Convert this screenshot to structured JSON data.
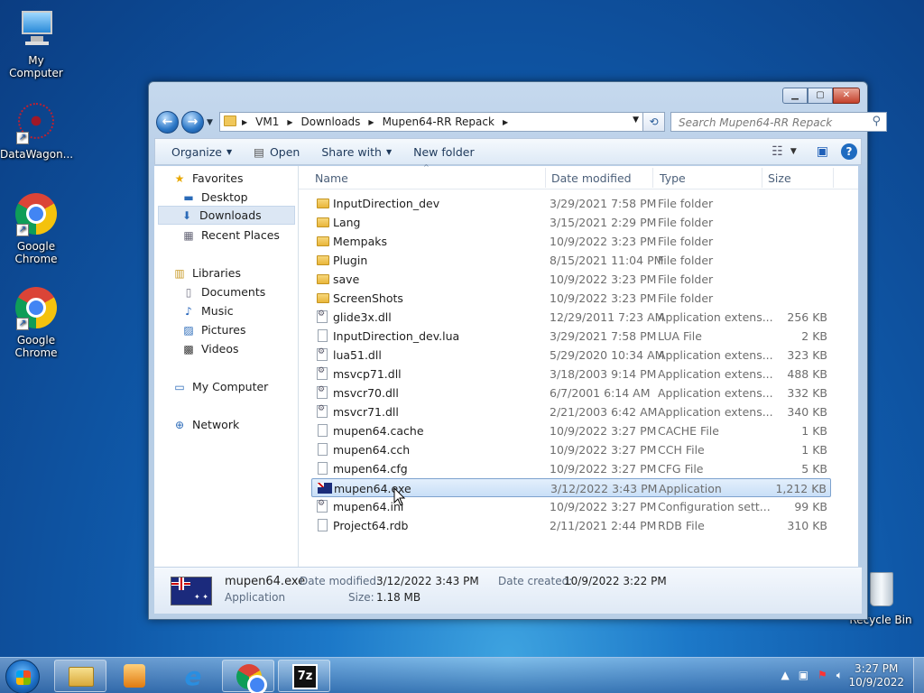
{
  "desktop": {
    "icons": [
      {
        "label": "My Computer"
      },
      {
        "label": "DataWagon..."
      },
      {
        "label": "Google Chrome"
      },
      {
        "label": "Google Chrome"
      },
      {
        "label": "Recycle Bin"
      }
    ]
  },
  "window": {
    "address": {
      "crumbs": [
        "VM1",
        "Downloads",
        "Mupen64-RR Repack"
      ]
    },
    "search": {
      "placeholder": "Search Mupen64-RR Repack"
    },
    "toolbar": {
      "organize": "Organize",
      "open": "Open",
      "share_with": "Share with",
      "new_folder": "New folder"
    },
    "nav": {
      "favorites": "Favorites",
      "desktop": "Desktop",
      "downloads": "Downloads",
      "recent_places": "Recent Places",
      "libraries": "Libraries",
      "documents": "Documents",
      "music": "Music",
      "pictures": "Pictures",
      "videos": "Videos",
      "my_computer": "My Computer",
      "network": "Network"
    },
    "columns": {
      "name": "Name",
      "date_modified": "Date modified",
      "type": "Type",
      "size": "Size"
    },
    "files": [
      {
        "icon": "folder",
        "name": "InputDirection_dev",
        "date": "3/29/2021 7:58 PM",
        "type": "File folder",
        "size": ""
      },
      {
        "icon": "folder",
        "name": "Lang",
        "date": "3/15/2021 2:29 PM",
        "type": "File folder",
        "size": ""
      },
      {
        "icon": "folder",
        "name": "Mempaks",
        "date": "10/9/2022 3:23 PM",
        "type": "File folder",
        "size": ""
      },
      {
        "icon": "folder",
        "name": "Plugin",
        "date": "8/15/2021 11:04 PM",
        "type": "File folder",
        "size": ""
      },
      {
        "icon": "folder",
        "name": "save",
        "date": "10/9/2022 3:23 PM",
        "type": "File folder",
        "size": ""
      },
      {
        "icon": "folder",
        "name": "ScreenShots",
        "date": "10/9/2022 3:23 PM",
        "type": "File folder",
        "size": ""
      },
      {
        "icon": "dll",
        "name": "glide3x.dll",
        "date": "12/29/2011 7:23 AM",
        "type": "Application extens...",
        "size": "256 KB"
      },
      {
        "icon": "file",
        "name": "InputDirection_dev.lua",
        "date": "3/29/2021 7:58 PM",
        "type": "LUA File",
        "size": "2 KB"
      },
      {
        "icon": "dll",
        "name": "lua51.dll",
        "date": "5/29/2020 10:34 AM",
        "type": "Application extens...",
        "size": "323 KB"
      },
      {
        "icon": "dll",
        "name": "msvcp71.dll",
        "date": "3/18/2003 9:14 PM",
        "type": "Application extens...",
        "size": "488 KB"
      },
      {
        "icon": "dll",
        "name": "msvcr70.dll",
        "date": "6/7/2001 6:14 AM",
        "type": "Application extens...",
        "size": "332 KB"
      },
      {
        "icon": "dll",
        "name": "msvcr71.dll",
        "date": "2/21/2003 6:42 AM",
        "type": "Application extens...",
        "size": "340 KB"
      },
      {
        "icon": "file",
        "name": "mupen64.cache",
        "date": "10/9/2022 3:27 PM",
        "type": "CACHE File",
        "size": "1 KB"
      },
      {
        "icon": "file",
        "name": "mupen64.cch",
        "date": "10/9/2022 3:27 PM",
        "type": "CCH File",
        "size": "1 KB"
      },
      {
        "icon": "file",
        "name": "mupen64.cfg",
        "date": "10/9/2022 3:27 PM",
        "type": "CFG File",
        "size": "5 KB"
      },
      {
        "icon": "exe",
        "name": "mupen64.exe",
        "date": "3/12/2022 3:43 PM",
        "type": "Application",
        "size": "1,212 KB"
      },
      {
        "icon": "dll",
        "name": "mupen64.ini",
        "date": "10/9/2022 3:27 PM",
        "type": "Configuration sett...",
        "size": "99 KB"
      },
      {
        "icon": "file",
        "name": "Project64.rdb",
        "date": "2/11/2021 2:44 PM",
        "type": "RDB File",
        "size": "310 KB"
      }
    ],
    "details": {
      "name": "mupen64.exe",
      "type": "Application",
      "date_modified_label": "Date modified:",
      "date_modified": "3/12/2022 3:43 PM",
      "size_label": "Size:",
      "size": "1.18 MB",
      "date_created_label": "Date created:",
      "date_created": "10/9/2022 3:22 PM"
    }
  },
  "taskbar": {
    "time": "3:27 PM",
    "date": "10/9/2022"
  }
}
